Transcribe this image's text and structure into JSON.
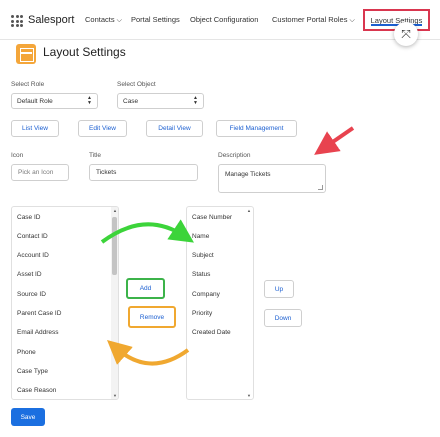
{
  "app": {
    "name": "Salesport"
  },
  "nav": {
    "items": [
      {
        "label": "Contacts",
        "has_menu": true
      },
      {
        "label": "Portal Settings",
        "has_menu": false
      },
      {
        "label": "Object Configuration",
        "has_menu": false
      },
      {
        "label": "Customer Portal Roles",
        "has_menu": true
      },
      {
        "label": "Layout Settings",
        "active": true
      }
    ]
  },
  "header": {
    "title": "Layout Settings"
  },
  "form": {
    "role_label": "Select Role",
    "role_value": "Default Role",
    "object_label": "Select Object",
    "object_value": "Case"
  },
  "tabs": [
    "List View",
    "Edit View",
    "Detail View",
    "Field Management"
  ],
  "fields": {
    "icon_label": "Icon",
    "icon_placeholder": "Pick an Icon",
    "title_label": "Title",
    "title_value": "Tickets",
    "description_label": "Description",
    "description_value": "Manage Tickets"
  },
  "available_fields": [
    "Case ID",
    "Contact ID",
    "Account ID",
    "Asset ID",
    "Source ID",
    "Parent Case ID",
    "Email Address",
    "Phone",
    "Case Type",
    "Case Reason"
  ],
  "selected_fields": [
    "Case Number",
    "Name",
    "Subject",
    "Status",
    "Company",
    "Priority",
    "Created Date"
  ],
  "buttons": {
    "add": "Add",
    "remove": "Remove",
    "up": "Up",
    "down": "Down",
    "save": "Save"
  },
  "colors": {
    "accent": "#1b5fd1",
    "highlight_red": "#d9364f",
    "add_green": "#3cb34a",
    "remove_orange": "#f0a830",
    "header_icon": "#f4a63a"
  }
}
